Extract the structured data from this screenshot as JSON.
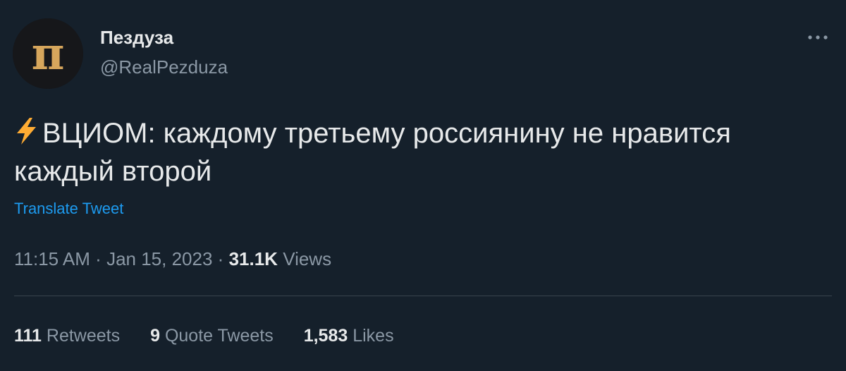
{
  "author": {
    "display_name": "Пездуза",
    "handle": "@RealPezduza",
    "avatar_letter": "п"
  },
  "tweet": {
    "text": "ВЦИОМ: каждому третьему россиянину не нравится каждый второй",
    "translate_label": "Translate Tweet"
  },
  "meta": {
    "time": "11:15 AM",
    "separator": "·",
    "date": "Jan 15, 2023",
    "views_count": "31.1K",
    "views_label": "Views"
  },
  "stats": {
    "retweets_count": "111",
    "retweets_label": "Retweets",
    "quotes_count": "9",
    "quotes_label": "Quote Tweets",
    "likes_count": "1,583",
    "likes_label": "Likes"
  },
  "colors": {
    "background": "#15202b",
    "text": "#e7e9ea",
    "muted": "#8b98a5",
    "link": "#1d9bf0",
    "avatar_gold": "#d6a65c"
  },
  "icons": [
    "avatar-logo",
    "more-icon",
    "lightning-bolt-icon"
  ]
}
